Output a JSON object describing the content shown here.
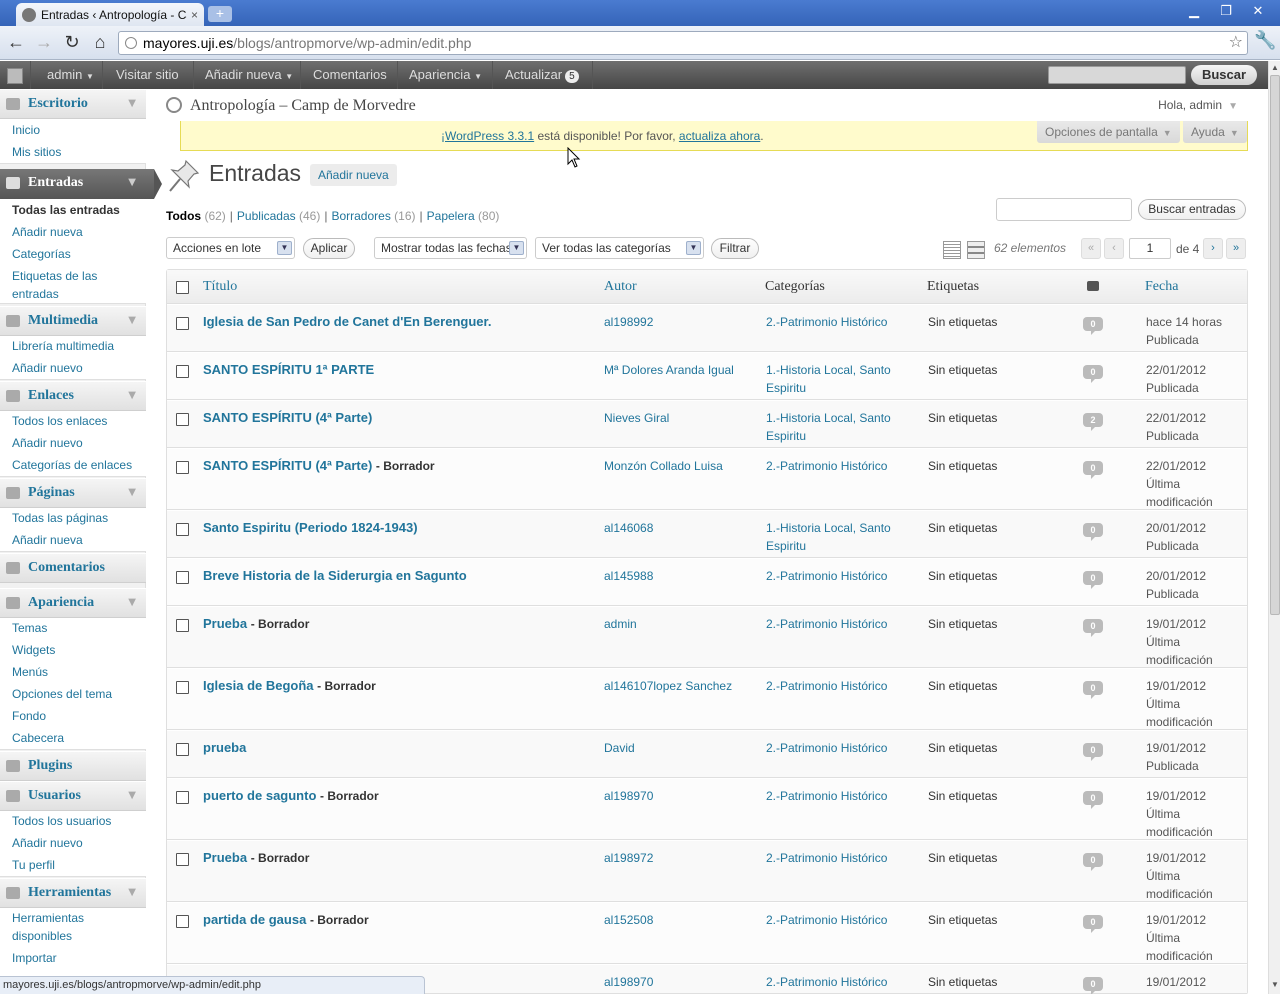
{
  "browser": {
    "tab_title": "Entradas ‹ Antropología - Cam",
    "tab_close": "×",
    "new_tab": "+",
    "url_host": "mayores.uji.es",
    "url_path": "/blogs/antropmorve/wp-admin/edit.php",
    "status_url": "mayores.uji.es/blogs/antropmorve/wp-admin/edit.php"
  },
  "adminbar": {
    "user": "admin",
    "visit": "Visitar sitio",
    "add_new": "Añadir nueva",
    "comments": "Comentarios",
    "appearance": "Apariencia",
    "update": "Actualizar",
    "update_count": "5",
    "search_button": "Buscar"
  },
  "header": {
    "site_title": "Antropología – Camp de Morvedre",
    "howdy": "Hola, admin",
    "screen_options": "Opciones de pantalla",
    "help": "Ayuda"
  },
  "notice": {
    "link1": "¡WordPress 3.3.1",
    "middle": " está disponible! Por favor, ",
    "link2": "actualiza ahora",
    "end": "."
  },
  "sidebar": {
    "escritorio": "Escritorio",
    "inicio": "Inicio",
    "mis_sitios": "Mis sitios",
    "entradas": "Entradas",
    "todas_entradas": "Todas las entradas",
    "anadir_nueva": "Añadir nueva",
    "categorias": "Categorías",
    "etiquetas": "Etiquetas de las entradas",
    "multimedia": "Multimedia",
    "libreria": "Librería multimedia",
    "anadir_nuevo_m": "Añadir nuevo",
    "enlaces": "Enlaces",
    "todos_enlaces": "Todos los enlaces",
    "anadir_nuevo_e": "Añadir nuevo",
    "cat_enlaces": "Categorías de enlaces",
    "paginas": "Páginas",
    "todas_paginas": "Todas las páginas",
    "anadir_nueva_p": "Añadir nueva",
    "comentarios": "Comentarios",
    "apariencia": "Apariencia",
    "temas": "Temas",
    "widgets": "Widgets",
    "menus": "Menús",
    "opciones_tema": "Opciones del tema",
    "fondo": "Fondo",
    "cabecera": "Cabecera",
    "plugins": "Plugins",
    "usuarios": "Usuarios",
    "todos_usuarios": "Todos los usuarios",
    "anadir_nuevo_u": "Añadir nuevo",
    "tu_perfil": "Tu perfil",
    "herramientas": "Herramientas",
    "herr_disp": "Herramientas disponibles",
    "importar": "Importar"
  },
  "page": {
    "title": "Entradas",
    "add_new": "Añadir nueva",
    "filters": {
      "all": "Todos",
      "all_count": "(62)",
      "published": "Publicadas",
      "published_count": "(46)",
      "drafts": "Borradores",
      "drafts_count": "(16)",
      "trash": "Papelera",
      "trash_count": "(80)"
    },
    "search_button": "Buscar entradas",
    "bulk_actions": "Acciones en lote",
    "apply": "Aplicar",
    "dates": "Mostrar todas las fechas",
    "categories": "Ver todas las categorías",
    "filter": "Filtrar",
    "items_count": "62 elementos",
    "first": "«",
    "prev": "‹",
    "current_page": "1",
    "of_pages": "de 4",
    "next": "›",
    "last": "»"
  },
  "table": {
    "headers": {
      "title": "Título",
      "author": "Autor",
      "categories": "Categorías",
      "tags": "Etiquetas",
      "date": "Fecha"
    },
    "rows": [
      {
        "title": "Iglesia de San Pedro de Canet d'En Berenguer.",
        "state": "",
        "author": "al198992",
        "cat": "2.-Patrimonio Histórico",
        "tags": "Sin etiquetas",
        "comments": "0",
        "date": "hace 14 horas",
        "status": "Publicada"
      },
      {
        "title": "SANTO ESPÍRITU 1ª PARTE",
        "state": "",
        "author": "Mª Dolores Aranda Igual",
        "cat": "1.-Historia Local, Santo Espiritu",
        "tags": "Sin etiquetas",
        "comments": "0",
        "date": "22/01/2012",
        "status": "Publicada"
      },
      {
        "title": "SANTO ESPÍRITU (4ª Parte)",
        "state": "",
        "author": "Nieves Giral",
        "cat": "1.-Historia Local, Santo Espiritu",
        "tags": "Sin etiquetas",
        "comments": "2",
        "date": "22/01/2012",
        "status": "Publicada"
      },
      {
        "title": "SANTO ESPÍRITU (4ª Parte)",
        "state": "- Borrador",
        "author": "Monzón Collado Luisa",
        "cat": "2.-Patrimonio Histórico",
        "tags": "Sin etiquetas",
        "comments": "0",
        "date": "22/01/2012",
        "status": "Última modificación"
      },
      {
        "title": "Santo Espiritu (Periodo 1824-1943)",
        "state": "",
        "author": "al146068",
        "cat": "1.-Historia Local, Santo Espiritu",
        "tags": "Sin etiquetas",
        "comments": "0",
        "date": "20/01/2012",
        "status": "Publicada"
      },
      {
        "title": "Breve Historia de la Siderurgia en Sagunto",
        "state": "",
        "author": "al145988",
        "cat": "2.-Patrimonio Histórico",
        "tags": "Sin etiquetas",
        "comments": "0",
        "date": "20/01/2012",
        "status": "Publicada"
      },
      {
        "title": "Prueba",
        "state": "- Borrador",
        "author": "admin",
        "cat": "2.-Patrimonio Histórico",
        "tags": "Sin etiquetas",
        "comments": "0",
        "date": "19/01/2012",
        "status": "Última modificación"
      },
      {
        "title": "Iglesia de Begoña",
        "state": "- Borrador",
        "author": "al146107lopez Sanchez",
        "cat": "2.-Patrimonio Histórico",
        "tags": "Sin etiquetas",
        "comments": "0",
        "date": "19/01/2012",
        "status": "Última modificación"
      },
      {
        "title": "prueba",
        "state": "",
        "author": "David",
        "cat": "2.-Patrimonio Histórico",
        "tags": "Sin etiquetas",
        "comments": "0",
        "date": "19/01/2012",
        "status": "Publicada"
      },
      {
        "title": "puerto de sagunto",
        "state": "- Borrador",
        "author": "al198970",
        "cat": "2.-Patrimonio Histórico",
        "tags": "Sin etiquetas",
        "comments": "0",
        "date": "19/01/2012",
        "status": "Última modificación"
      },
      {
        "title": "Prueba",
        "state": "- Borrador",
        "author": "al198972",
        "cat": "2.-Patrimonio Histórico",
        "tags": "Sin etiquetas",
        "comments": "0",
        "date": "19/01/2012",
        "status": "Última modificación"
      },
      {
        "title": "partida de gausa",
        "state": "- Borrador",
        "author": "al152508",
        "cat": "2.-Patrimonio Histórico",
        "tags": "Sin etiquetas",
        "comments": "0",
        "date": "19/01/2012",
        "status": "Última modificación"
      },
      {
        "title": "",
        "state": "",
        "author": "al198970",
        "cat": "2.-Patrimonio Histórico",
        "tags": "Sin etiquetas",
        "comments": "0",
        "date": "19/01/2012",
        "status": ""
      }
    ]
  },
  "colors": {
    "link": "#21759b",
    "admin_bar": "#464646",
    "notice_bg": "#fffbcc"
  }
}
